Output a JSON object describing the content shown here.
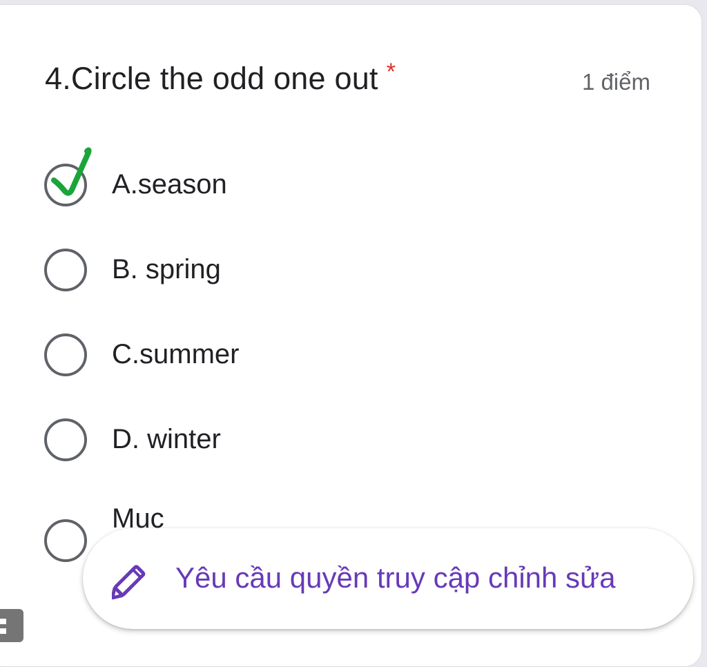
{
  "question": {
    "number_title": "4.Circle the odd one out",
    "required_marker": "*",
    "points": "1 điểm"
  },
  "options": [
    {
      "label": "A.season",
      "annotated_check": true,
      "check_color": "#1aa53a"
    },
    {
      "label": "B. spring",
      "annotated_check": false
    },
    {
      "label": "C.summer",
      "annotated_check": false
    },
    {
      "label": "D. winter",
      "annotated_check": false
    },
    {
      "label": "Muc",
      "annotated_check": false
    }
  ],
  "edit_request": {
    "label": "Yêu cầu quyền truy cập chỉnh sửa",
    "icon": "pencil-icon",
    "color": "#673ab7"
  },
  "colors": {
    "required": "#d93025",
    "radio_border": "#5f6368",
    "text": "#202124"
  }
}
